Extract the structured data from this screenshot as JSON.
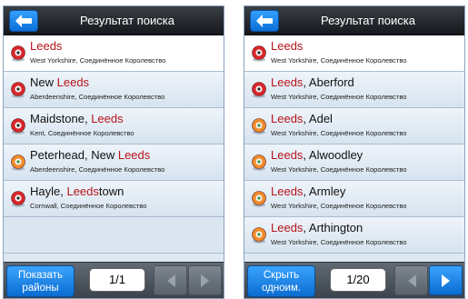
{
  "left": {
    "title": "Результат поиска",
    "results": [
      {
        "prefix": "",
        "highlight": "Leeds",
        "suffix": "",
        "region": "West Yorkshire, Соединённое Королевство",
        "pin": "red-pin-icon",
        "selected": true
      },
      {
        "prefix": "New ",
        "highlight": "Leeds",
        "suffix": "",
        "region": "Aberdeenshire, Соединённое Королевство",
        "pin": "red-pin-icon",
        "selected": false
      },
      {
        "prefix": "Maidstone, ",
        "highlight": "Leeds",
        "suffix": "",
        "region": "Kent, Соединённое Королевство",
        "pin": "red-pin-icon",
        "selected": false
      },
      {
        "prefix": "Peterhead, New ",
        "highlight": "Leeds",
        "suffix": "",
        "region": "Aberdeenshire, Соединённое Королевство",
        "pin": "orange-pin-icon",
        "selected": false
      },
      {
        "prefix": "Hayle, ",
        "highlight": "Leeds",
        "suffix": "town",
        "region": "Cornwall, Соединённое Королевство",
        "pin": "red-pin-icon",
        "selected": false
      }
    ],
    "action_button": {
      "line1": "Показать",
      "line2": "районы"
    },
    "page": "1/1",
    "prev_enabled": false,
    "next_enabled": false
  },
  "right": {
    "title": "Результат поиска",
    "results": [
      {
        "prefix": "",
        "highlight": "Leeds",
        "suffix": "",
        "region": "West Yorkshire, Соединённое Королевство",
        "pin": "red-pin-icon",
        "selected": true
      },
      {
        "prefix": "",
        "highlight": "Leeds",
        "suffix": ", Aberford",
        "region": "West Yorkshire, Соединённое Королевство",
        "pin": "red-pin-icon",
        "selected": false
      },
      {
        "prefix": "",
        "highlight": "Leeds",
        "suffix": ", Adel",
        "region": "West Yorkshire, Соединённое Королевство",
        "pin": "orange-pin-icon",
        "selected": false
      },
      {
        "prefix": "",
        "highlight": "Leeds",
        "suffix": ", Alwoodley",
        "region": "West Yorkshire, Соединённое Королевство",
        "pin": "orange-pin-icon",
        "selected": false
      },
      {
        "prefix": "",
        "highlight": "Leeds",
        "suffix": ", Armley",
        "region": "West Yorkshire, Соединённое Королевство",
        "pin": "orange-pin-icon",
        "selected": false
      },
      {
        "prefix": "",
        "highlight": "Leeds",
        "suffix": ", Arthington",
        "region": "West Yorkshire, Соединённое Королевство",
        "pin": "orange-pin-icon",
        "selected": false
      }
    ],
    "action_button": {
      "line1": "Скрыть",
      "line2": "одноим."
    },
    "page": "1/20",
    "prev_enabled": false,
    "next_enabled": true
  },
  "colors": {
    "highlight_text": "#b8141a",
    "accent_blue": "#1a86f0",
    "pin_red": "#d9262b",
    "pin_orange": "#f08a2a"
  }
}
